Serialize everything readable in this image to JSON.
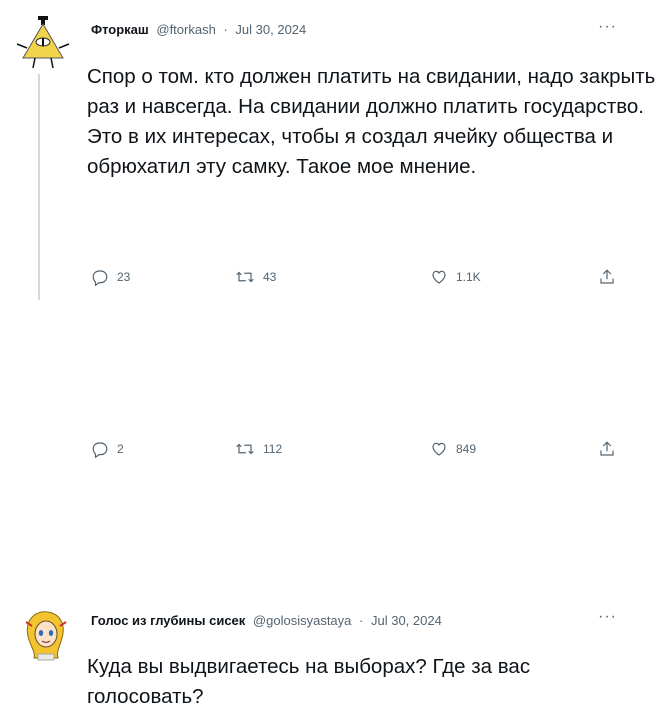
{
  "tweets": [
    {
      "name": "Фторкаш",
      "handle": "@ftorkash",
      "date": "Jul 30, 2024",
      "text": "Спор о том. кто должен платить на свидании, надо закрыть раз и навсегда. На свидании должно платить государство. Это в их интересах, чтобы я создал ячейку общества и обрюхатил эту самку. Такое мое мнение.",
      "replies": "23",
      "retweets": "43",
      "likes": "1.1K",
      "more": "···"
    },
    {
      "name": "Голос из глубины сисек",
      "handle": "@golosisyastaya",
      "date": "Jul 30, 2024",
      "text": "Куда вы выдвигаетесь на выборах? Где за вас голосовать?",
      "replies": "2",
      "retweets": "112",
      "likes": "849",
      "more": "···"
    }
  ],
  "separator": "·",
  "colors": {
    "text": "#0f1419",
    "secondary": "#536471",
    "thread": "#cfd9de",
    "triangle": "#f2d44a"
  },
  "icons": [
    "bill-cipher-avatar",
    "anime-girl-avatar",
    "reply-icon",
    "retweet-icon",
    "like-icon",
    "share-icon",
    "more-icon"
  ]
}
